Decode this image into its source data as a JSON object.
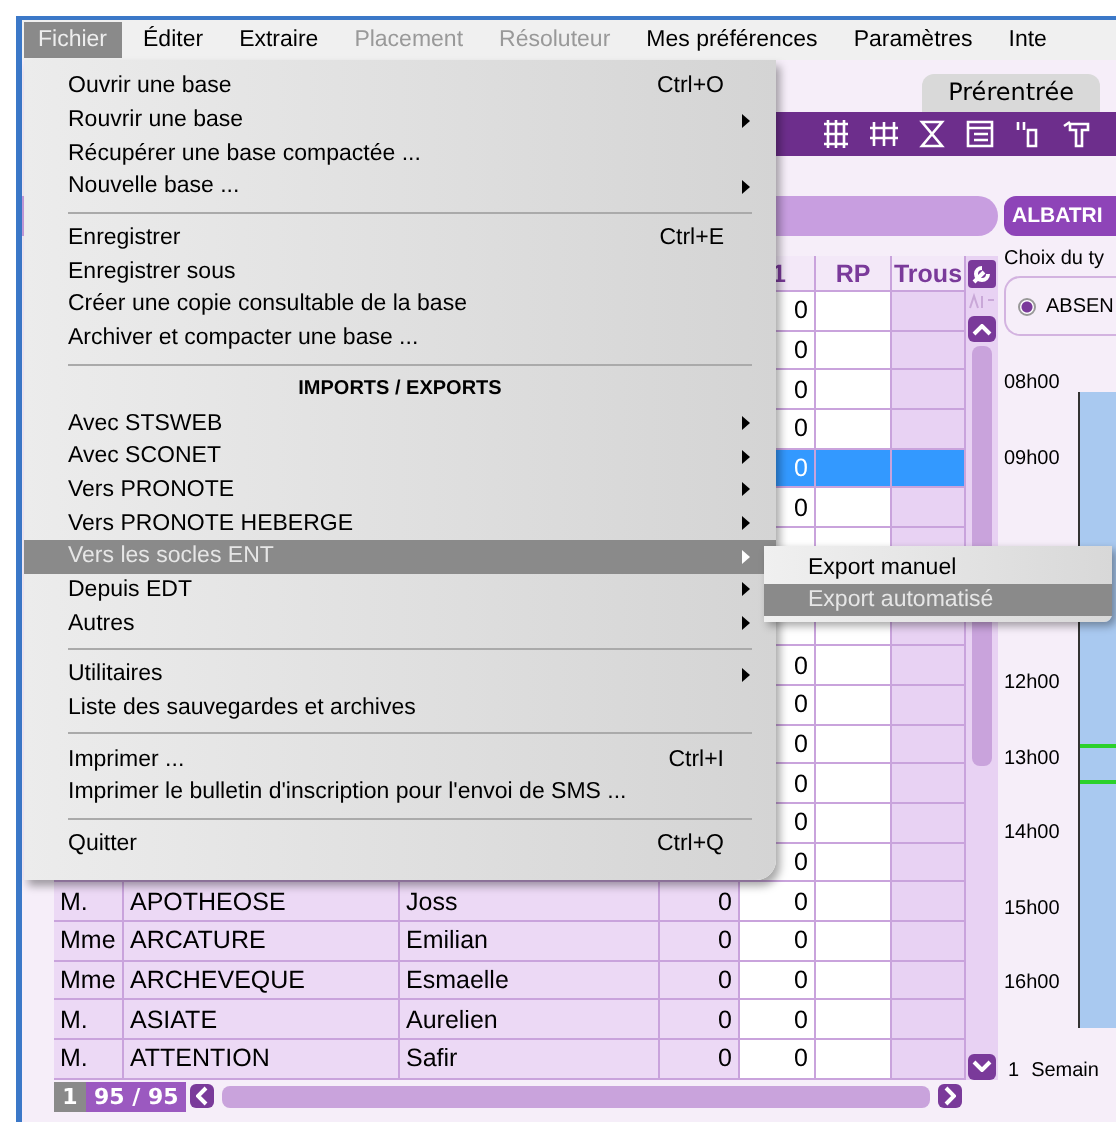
{
  "menubar": [
    {
      "label": "Fichier",
      "selected": true,
      "disabled": false
    },
    {
      "label": "Éditer",
      "selected": false,
      "disabled": false
    },
    {
      "label": "Extraire",
      "selected": false,
      "disabled": false
    },
    {
      "label": "Placement",
      "selected": false,
      "disabled": true
    },
    {
      "label": "Résoluteur",
      "selected": false,
      "disabled": true
    },
    {
      "label": "Mes préférences",
      "selected": false,
      "disabled": false
    },
    {
      "label": "Paramètres",
      "selected": false,
      "disabled": false
    },
    {
      "label": "Inte",
      "selected": false,
      "disabled": false
    }
  ],
  "tabs": [
    {
      "label": "Prérentrée",
      "selected": false
    }
  ],
  "table": {
    "header": {
      "column_5": "1",
      "rp": "RP",
      "trous": "Trous"
    },
    "rows": [
      {
        "column_5": "0",
        "selected": false
      },
      {
        "column_5": "0",
        "selected": false
      },
      {
        "column_5": "0",
        "selected": false
      },
      {
        "column_5": "0",
        "selected": false
      },
      {
        "column_5": "0",
        "selected": true
      },
      {
        "column_5": "0",
        "selected": false
      },
      {
        "selected": false
      },
      {},
      {
        "selected": false
      },
      {
        "column_5": "0",
        "selected": false
      },
      {
        "column_5": "0",
        "selected": false
      },
      {
        "column_5": "0",
        "selected": false
      },
      {
        "column_5": "0",
        "selected": false
      },
      {
        "column_5": "0",
        "selected": false
      },
      {
        "column_5": "0",
        "selected": false
      },
      {
        "civility": "M.",
        "last_name": "APOTHEOSE",
        "first_name": "Joss",
        "column_4": "0",
        "column_5": "0",
        "selected": false
      },
      {
        "civility": "Mme",
        "last_name": "ARCATURE",
        "first_name": "Emilian",
        "column_4": "0",
        "column_5": "0",
        "selected": false
      },
      {
        "civility": "Mme",
        "last_name": "ARCHEVEQUE",
        "first_name": "Esmaelle",
        "column_4": "0",
        "column_5": "0",
        "selected": false
      },
      {
        "civility": "M.",
        "last_name": "ASIATE",
        "first_name": "Aurelien",
        "column_4": "0",
        "column_5": "0",
        "selected": false
      },
      {
        "civility": "M.",
        "last_name": "ATTENTION",
        "first_name": "Safir",
        "column_4": "0",
        "column_5": "0",
        "selected": false
      }
    ],
    "pager": {
      "page": "1",
      "count": "95 / 95"
    }
  },
  "right_panel": {
    "title": "ALBATRI",
    "prompt": "Choix du ty",
    "radio": {
      "label": "ABSEN",
      "selected": true
    },
    "hours_top": [
      "08h00",
      "09h00"
    ],
    "hours_bottom": [
      "12h00",
      "13h00",
      "14h00",
      "15h00",
      "16h00"
    ],
    "footer": {
      "number": "1",
      "label": "Semain"
    }
  },
  "menu": {
    "items": [
      {
        "kind": "item",
        "label": "Ouvrir une base",
        "shortcut": "Ctrl+O",
        "has_submenu": false,
        "selected": false
      },
      {
        "kind": "item",
        "label": "Rouvrir une base",
        "has_submenu": true,
        "selected": false
      },
      {
        "kind": "item",
        "label": "Récupérer une base compactée ...",
        "has_submenu": false,
        "selected": false
      },
      {
        "kind": "item",
        "label": "Nouvelle base ...",
        "has_submenu": true,
        "selected": false
      },
      {
        "kind": "separator"
      },
      {
        "kind": "item",
        "label": "Enregistrer",
        "shortcut": "Ctrl+E",
        "has_submenu": false,
        "selected": false
      },
      {
        "kind": "item",
        "label": "Enregistrer sous",
        "has_submenu": false,
        "selected": false
      },
      {
        "kind": "item",
        "label": "Créer une copie consultable de la base",
        "has_submenu": false,
        "selected": false
      },
      {
        "kind": "item",
        "label": "Archiver et compacter une base ...",
        "has_submenu": false,
        "selected": false
      },
      {
        "kind": "separator"
      },
      {
        "kind": "header",
        "label": "IMPORTS / EXPORTS"
      },
      {
        "kind": "item",
        "label": "Avec STSWEB",
        "has_submenu": true,
        "selected": false
      },
      {
        "kind": "item",
        "label": "Avec SCONET",
        "has_submenu": true,
        "selected": false
      },
      {
        "kind": "item",
        "label": "Vers PRONOTE",
        "has_submenu": true,
        "selected": false
      },
      {
        "kind": "item",
        "label": "Vers PRONOTE HEBERGE",
        "has_submenu": true,
        "selected": false
      },
      {
        "kind": "item",
        "label": "Vers les socles ENT",
        "has_submenu": true,
        "selected": true
      },
      {
        "kind": "item",
        "label": "Depuis EDT",
        "has_submenu": true,
        "selected": false
      },
      {
        "kind": "item",
        "label": "Autres",
        "has_submenu": true,
        "selected": false
      },
      {
        "kind": "separator"
      },
      {
        "kind": "item",
        "label": "Utilitaires",
        "has_submenu": true,
        "selected": false
      },
      {
        "kind": "item",
        "label": "Liste des sauvegardes et archives",
        "has_submenu": false,
        "selected": false
      },
      {
        "kind": "separator"
      },
      {
        "kind": "item",
        "label": "Imprimer ...",
        "shortcut": "Ctrl+I",
        "has_submenu": false,
        "selected": false
      },
      {
        "kind": "item",
        "label": "Imprimer le bulletin d'inscription pour l'envoi de SMS ...",
        "has_submenu": false,
        "selected": false
      },
      {
        "kind": "separator"
      },
      {
        "kind": "item",
        "label": "Quitter",
        "shortcut": "Ctrl+Q",
        "has_submenu": false,
        "selected": false
      }
    ]
  },
  "submenu": {
    "items": [
      {
        "label": "Export manuel",
        "selected": false
      },
      {
        "label": "Export automatisé",
        "selected": true
      }
    ]
  }
}
